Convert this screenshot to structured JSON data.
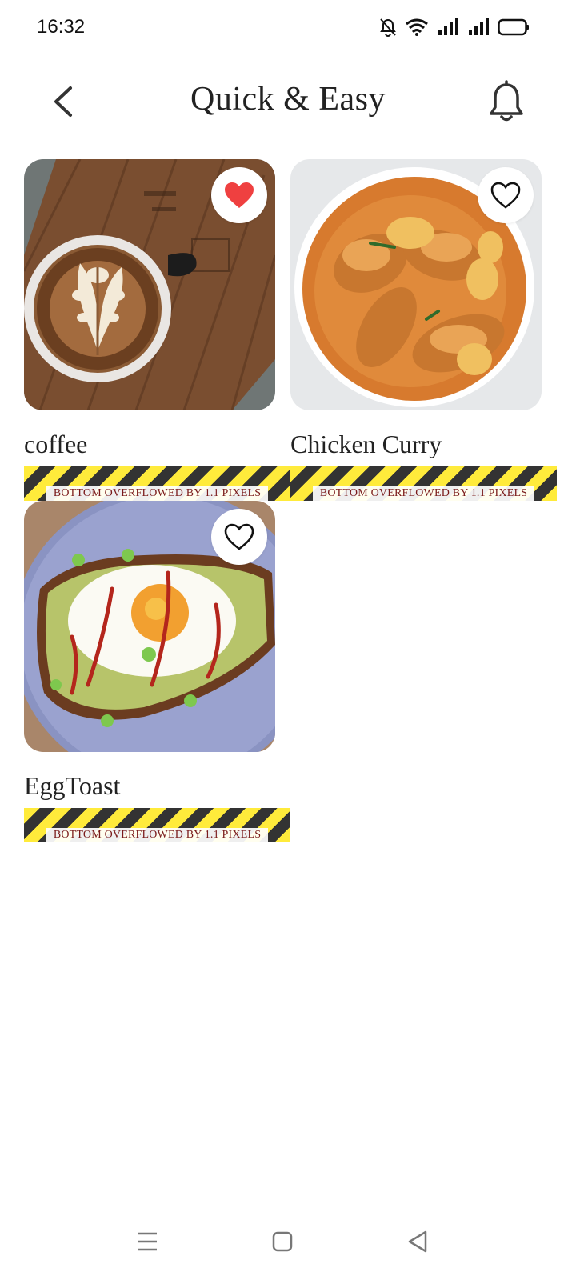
{
  "status_bar": {
    "time": "16:32"
  },
  "app_bar": {
    "title": "Quick & Easy"
  },
  "recipes": [
    {
      "name": "coffee",
      "favorited": true,
      "overflow_text": "BOTTOM OVERFLOWED BY 1.1 PIXELS"
    },
    {
      "name": "Chicken Curry",
      "favorited": false,
      "overflow_text": "BOTTOM OVERFLOWED BY 1.1 PIXELS"
    },
    {
      "name": "EggToast",
      "favorited": false,
      "overflow_text": "BOTTOM OVERFLOWED BY 1.1 PIXELS"
    }
  ],
  "colors": {
    "favorite_active": "#ef4040",
    "overflow_stripe_yellow": "#ffeb3b",
    "overflow_stripe_dark": "#333333"
  },
  "icons": [
    "mute-icon",
    "wifi-icon",
    "signal-icon",
    "battery-icon",
    "back-arrow-icon",
    "bell-icon",
    "heart-icon",
    "menu-icon",
    "home-icon",
    "back-triangle-icon"
  ]
}
